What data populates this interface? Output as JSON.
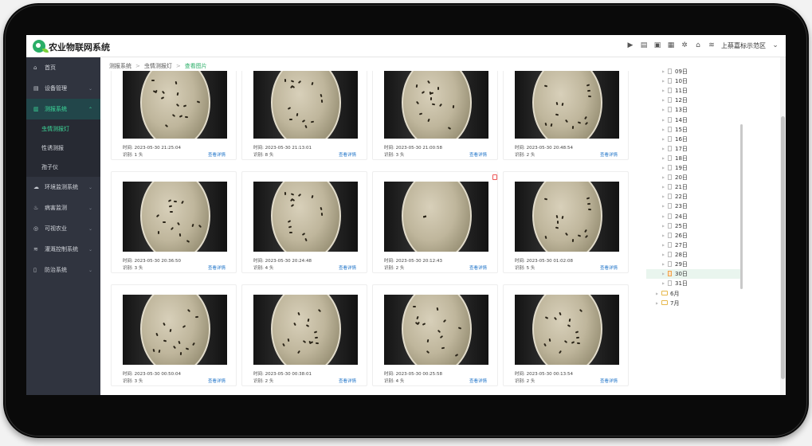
{
  "app": {
    "title": "农业物联网系统"
  },
  "topbar": {
    "region": "上蔡嘉标示范区"
  },
  "sidebar": {
    "items": [
      {
        "label": "首页",
        "icon": "home-icon",
        "glyph": "⌂"
      },
      {
        "label": "设备管理",
        "icon": "device-icon",
        "glyph": "▤"
      },
      {
        "label": "测报系统",
        "icon": "monitor-icon",
        "glyph": "▥"
      },
      {
        "label": "环境监测系统",
        "icon": "environment-icon",
        "glyph": "☁"
      },
      {
        "label": "病害监测",
        "icon": "disease-icon",
        "glyph": "♨"
      },
      {
        "label": "可视农业",
        "icon": "camera-icon",
        "glyph": "◎"
      },
      {
        "label": "灌溉控制系统",
        "icon": "irrigation-icon",
        "glyph": "≋"
      },
      {
        "label": "防治系统",
        "icon": "prevention-icon",
        "glyph": "▯"
      }
    ],
    "subitems": [
      {
        "label": "虫情测报灯"
      },
      {
        "label": "性诱测报"
      },
      {
        "label": "孢子仪"
      }
    ]
  },
  "breadcrumb": {
    "items": [
      "测报系统",
      "虫情测报灯",
      "查看图片"
    ]
  },
  "gallery": {
    "time_prefix": "时间: ",
    "count_prefix": "识别: ",
    "count_unit": " 头",
    "detail_label": "查看详情",
    "cards": [
      {
        "time": "2023-05-30 21:25:04",
        "count": "1"
      },
      {
        "time": "2023-05-30 21:13:01",
        "count": "8"
      },
      {
        "time": "2023-05-30 21:00:58",
        "count": "3"
      },
      {
        "time": "2023-05-30 20:48:54",
        "count": "2"
      },
      {
        "time": "2023-05-30 20:36:50",
        "count": "3"
      },
      {
        "time": "2023-05-30 20:24:48",
        "count": "4"
      },
      {
        "time": "2023-05-30 20:12:43",
        "count": "2"
      },
      {
        "time": "2023-05-30 01:02:08",
        "count": "5"
      },
      {
        "time": "2023-05-30 00:50:04",
        "count": "3"
      },
      {
        "time": "2023-05-30 00:38:01",
        "count": "2"
      },
      {
        "time": "2023-05-30 00:25:58",
        "count": "4"
      },
      {
        "time": "2023-05-30 00:13:54",
        "count": "2"
      }
    ]
  },
  "tree": {
    "days": [
      "09日",
      "10日",
      "11日",
      "12日",
      "13日",
      "14日",
      "15日",
      "16日",
      "17日",
      "18日",
      "19日",
      "20日",
      "21日",
      "22日",
      "23日",
      "24日",
      "25日",
      "26日",
      "27日",
      "28日",
      "29日",
      "30日",
      "31日"
    ],
    "selected_day": "30日",
    "months": [
      "6月",
      "7月"
    ]
  }
}
